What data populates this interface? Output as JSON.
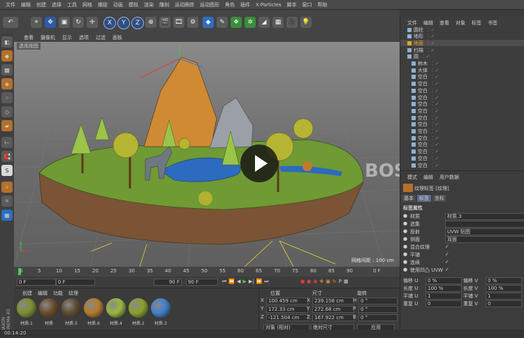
{
  "menu": [
    "文件",
    "编辑",
    "创建",
    "选择",
    "工具",
    "网格",
    "捕捉",
    "动画",
    "模拟",
    "渲染",
    "雕刻",
    "运动跟踪",
    "运动图形",
    "角色",
    "插件",
    "X-Particles",
    "脚本",
    "窗口",
    "帮助"
  ],
  "toolbar": {
    "axis_x": "X",
    "axis_y": "Y",
    "axis_z": "Z"
  },
  "viewport": {
    "menu": [
      "查看",
      "摄像机",
      "显示",
      "选项",
      "过滤",
      "面板"
    ],
    "label": "透视视图",
    "grid_spacing": "网格间距 : 100 cm"
  },
  "timeline": {
    "ticks": [
      "0",
      "5",
      "10",
      "15",
      "20",
      "25",
      "30",
      "35",
      "40",
      "45",
      "50",
      "55",
      "60",
      "65",
      "70",
      "75",
      "80",
      "85",
      "90"
    ],
    "end_frame": "0 F"
  },
  "transport": {
    "start": "0 F",
    "cur": "0 F",
    "max": "90 F",
    "end": "90 F"
  },
  "materials": {
    "menu": [
      "创建",
      "编辑",
      "功能",
      "纹理"
    ],
    "items": [
      "材质.1",
      "材质",
      "材质.5",
      "材质.6",
      "材质.4",
      "材质.2",
      "材质.3"
    ],
    "colors": [
      "#7a8f2c",
      "#6b4a2a",
      "#5e4a2f",
      "#b57b2c",
      "#9ab83a",
      "#8aa22a",
      "#3f7fd0"
    ]
  },
  "coords": {
    "headers": [
      "位置",
      "尺寸",
      "旋转"
    ],
    "rows": [
      {
        "ax": "X",
        "pos": "100.459 cm",
        "sx": "X",
        "size": "239.158 cm",
        "rx": "H",
        "rot": "0 °"
      },
      {
        "ax": "Y",
        "pos": "172.33 cm",
        "sx": "Y",
        "size": "272.68 cm",
        "rx": "P",
        "rot": "0 °"
      },
      {
        "ax": "Z",
        "pos": "-121.504 cm",
        "sx": "Z",
        "size": "167.922 cm",
        "rx": "B",
        "rot": "0 °"
      }
    ],
    "mode": "对象 (相对)",
    "size_mode": "绝对尺寸",
    "apply": "应用"
  },
  "objects": {
    "menu": [
      "文件",
      "编辑",
      "查看",
      "对象",
      "标签",
      "书签"
    ],
    "items": [
      "圆柱",
      "地形",
      "地面",
      "扫描",
      "圆",
      "树木",
      "大体",
      "空白",
      "空白",
      "空白",
      "空白",
      "空白",
      "空白",
      "空白",
      "空白",
      "空白",
      "空白",
      "空白",
      "空白",
      "空白",
      "空白"
    ]
  },
  "attributes": {
    "menu": [
      "模式",
      "编辑",
      "用户数据"
    ],
    "title": "纹理标签 [纹理]",
    "tabs": [
      "基本",
      "标签",
      "坐标"
    ],
    "section": "标签属性",
    "props": [
      {
        "label": "材质",
        "value": "材质.3"
      },
      {
        "label": "选集",
        "value": ""
      },
      {
        "label": "投射",
        "value": "UVW 贴图"
      },
      {
        "label": "侧面",
        "value": "双面"
      },
      {
        "label": "混合纹理",
        "value": ""
      },
      {
        "label": "平铺",
        "value": ""
      },
      {
        "label": "连续",
        "value": ""
      },
      {
        "label": "使用凹凸 UVW",
        "value": ""
      }
    ],
    "offsets": [
      {
        "l1": "偏移 U",
        "v1": "0 %",
        "l2": "偏移 V",
        "v2": "0 %"
      },
      {
        "l1": "长度 U",
        "v1": "100 %",
        "l2": "长度 V",
        "v2": "100 %"
      },
      {
        "l1": "平铺 U",
        "v1": "1",
        "l2": "平铺 V",
        "v2": "1"
      },
      {
        "l1": "重复 U",
        "v1": "0",
        "l2": "重复 V",
        "v2": "0"
      }
    ]
  },
  "watermark": "BOSS 资源",
  "statusbar": {
    "time": "00:14:20",
    "vertical_label": "MAXON CINEMA 4D"
  }
}
